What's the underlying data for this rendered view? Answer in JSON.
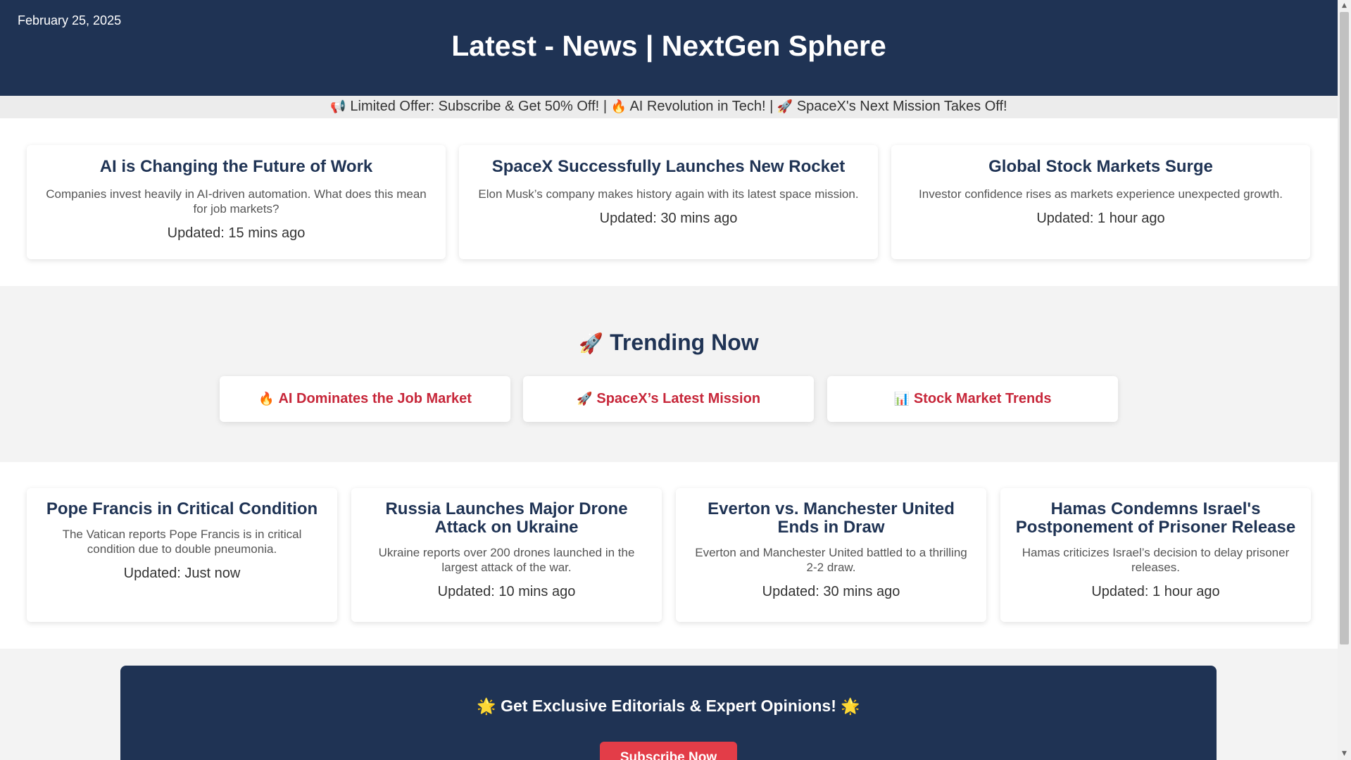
{
  "header": {
    "date": "February 25, 2025",
    "title": "Latest - News | NextGen Sphere"
  },
  "ticker": {
    "items": [
      {
        "icon": "📢",
        "text": "Limited Offer: Subscribe & Get 50% Off!"
      },
      {
        "icon": "🔥",
        "text": "AI Revolution in Tech!"
      },
      {
        "icon": "🚀",
        "text": "SpaceX's Next Mission Takes Off!"
      }
    ],
    "separator": "|"
  },
  "top_stories": [
    {
      "title": "AI is Changing the Future of Work",
      "summary": "Companies invest heavily in AI-driven automation. What does this mean for job markets?",
      "updated": "Updated: 15 mins ago"
    },
    {
      "title": "SpaceX Successfully Launches New Rocket",
      "summary": "Elon Musk’s company makes history again with its latest space mission.",
      "updated": "Updated: 30 mins ago"
    },
    {
      "title": "Global Stock Markets Surge",
      "summary": "Investor confidence rises as markets experience unexpected growth.",
      "updated": "Updated: 1 hour ago"
    }
  ],
  "trending": {
    "icon": "🚀",
    "title": "Trending Now",
    "items": [
      {
        "icon": "🔥",
        "label": "AI Dominates the Job Market"
      },
      {
        "icon": "🚀",
        "label": "SpaceX’s Latest Mission"
      },
      {
        "icon": "📊",
        "label": "Stock Market Trends"
      }
    ]
  },
  "news": [
    {
      "title": "Pope Francis in Critical Condition",
      "summary": "The Vatican reports Pope Francis is in critical condition due to double pneumonia.",
      "updated": "Updated: Just now"
    },
    {
      "title": "Russia Launches Major Drone Attack on Ukraine",
      "summary": "Ukraine reports over 200 drones launched in the largest attack of the war.",
      "updated": "Updated: 10 mins ago"
    },
    {
      "title": "Everton vs. Manchester United Ends in Draw",
      "summary": "Everton and Manchester United battled to a thrilling 2-2 draw.",
      "updated": "Updated: 30 mins ago"
    },
    {
      "title": "Hamas Condemns Israel's Postponement of Prisoner Release",
      "summary": "Hamas criticizes Israel’s decision to delay prisoner releases.",
      "updated": "Updated: 1 hour ago"
    }
  ],
  "subscribe": {
    "icon": "🌟",
    "heading": "Get Exclusive Editorials & Expert Opinions!",
    "button": "Subscribe Now"
  },
  "colors": {
    "navy": "#1f3354",
    "accent_red": "#c7273a",
    "button_red": "#e33d48"
  }
}
